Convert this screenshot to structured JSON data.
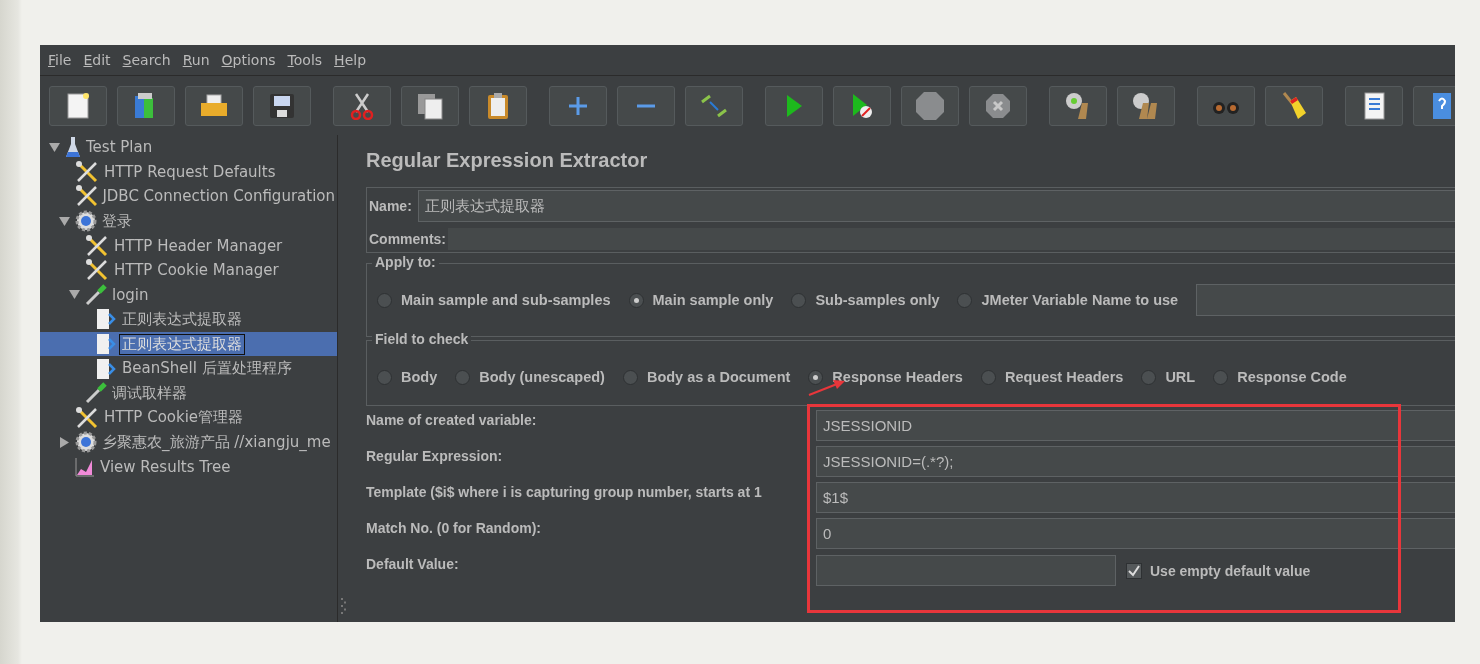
{
  "menu": [
    "File",
    "Edit",
    "Search",
    "Run",
    "Options",
    "Tools",
    "Help"
  ],
  "toolbar": [
    [
      {
        "kind": "new"
      },
      {
        "kind": "templates"
      },
      {
        "kind": "open"
      },
      {
        "kind": "save"
      }
    ],
    [
      {
        "kind": "cut"
      },
      {
        "kind": "copy"
      },
      {
        "kind": "paste"
      }
    ],
    [
      {
        "kind": "expand"
      },
      {
        "kind": "collapse"
      },
      {
        "kind": "toggle"
      }
    ],
    [
      {
        "kind": "start"
      },
      {
        "kind": "start-no-pauses"
      },
      {
        "kind": "stop"
      },
      {
        "kind": "shutdown"
      }
    ],
    [
      {
        "kind": "clear"
      },
      {
        "kind": "clear-all"
      }
    ],
    [
      {
        "kind": "search"
      },
      {
        "kind": "reset-search"
      }
    ],
    [
      {
        "kind": "function-helper"
      },
      {
        "kind": "help"
      }
    ]
  ],
  "tree": [
    {
      "label": "Test Plan",
      "kind": "flask",
      "expanded": true,
      "selected": false,
      "children": [
        {
          "label": "HTTP Request Defaults",
          "kind": "tools",
          "selected": false
        },
        {
          "label": "JDBC Connection Configuration",
          "kind": "tools",
          "selected": false
        },
        {
          "label": "登录",
          "kind": "gear",
          "expanded": true,
          "selected": false,
          "children": [
            {
              "label": "HTTP Header Manager",
              "kind": "tools",
              "selected": false
            },
            {
              "label": "HTTP Cookie Manager",
              "kind": "tools",
              "selected": false
            },
            {
              "label": "login",
              "kind": "pipette",
              "expanded": true,
              "selected": false,
              "children": [
                {
                  "label": "正则表达式提取器",
                  "kind": "post",
                  "selected": false
                },
                {
                  "label": "正则表达式提取器",
                  "kind": "post",
                  "selected": true
                },
                {
                  "label": "BeanShell 后置处理程序",
                  "kind": "post",
                  "selected": false
                }
              ]
            },
            {
              "label": "调试取样器",
              "kind": "pipette",
              "selected": false
            }
          ]
        },
        {
          "label": "HTTP Cookie管理器",
          "kind": "tools",
          "selected": false
        },
        {
          "label": "乡聚惠农_旅游产品 //xiangju_me",
          "kind": "gear",
          "expanded": false,
          "selected": false
        },
        {
          "label": "View Results Tree",
          "kind": "graph",
          "selected": false
        }
      ]
    }
  ],
  "editor": {
    "title": "Regular Expression Extractor",
    "name": {
      "label": "Name:",
      "value": "正则表达式提取器"
    },
    "comments": {
      "label": "Comments:"
    },
    "apply_to": {
      "legend": "Apply to:",
      "options": [
        {
          "label": "Main sample and sub-samples",
          "selected": false
        },
        {
          "label": "Main sample only",
          "selected": true
        },
        {
          "label": "Sub-samples only",
          "selected": false
        },
        {
          "label": "JMeter Variable Name to use",
          "selected": false
        }
      ]
    },
    "field_to_check": {
      "legend": "Field to check",
      "options": [
        {
          "label": "Body",
          "selected": false
        },
        {
          "label": "Body (unescaped)",
          "selected": false
        },
        {
          "label": "Body as a Document",
          "selected": false
        },
        {
          "label": "Response Headers",
          "selected": true
        },
        {
          "label": "Request Headers",
          "selected": false
        },
        {
          "label": "URL",
          "selected": false
        },
        {
          "label": "Response Code",
          "selected": false
        }
      ]
    },
    "rows": [
      {
        "label": "Name of created variable:",
        "value": "JSESSIONID"
      },
      {
        "label": "Regular Expression:",
        "value": "JSESSIONID=(.*?);"
      },
      {
        "label": "Template ($i$ where i is capturing group number, starts at 1",
        "value": "$1$"
      },
      {
        "label": "Match No. (0 for Random):",
        "value": "0"
      }
    ],
    "default_value": {
      "label": "Default Value:",
      "checkbox": {
        "label": "Use empty default value",
        "checked": true
      }
    }
  }
}
